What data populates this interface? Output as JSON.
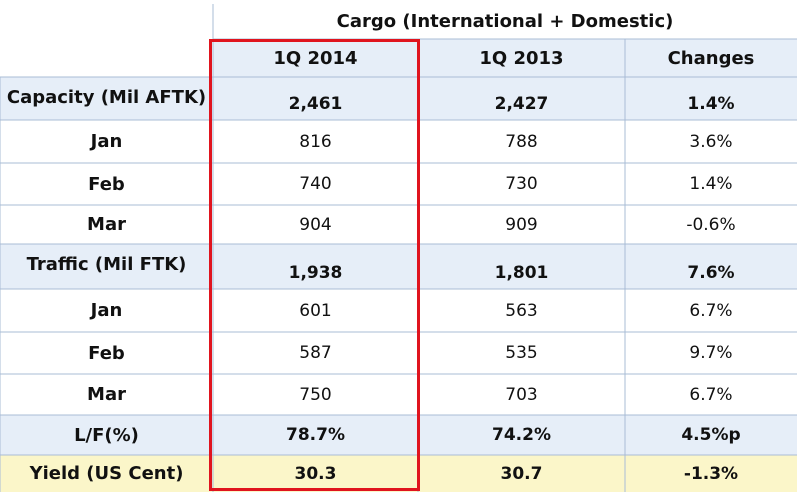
{
  "chart_data": {
    "type": "table",
    "group_header": "Cargo (International + Domestic)",
    "columns": [
      "1Q 2014",
      "1Q 2013",
      "Changes"
    ],
    "rows": [
      {
        "label": "Capacity (Mil AFTK)",
        "values": [
          "2,461",
          "2,427",
          "1.4%"
        ],
        "style": "summary"
      },
      {
        "label": "Jan",
        "values": [
          "816",
          "788",
          "3.6%"
        ],
        "style": "detail"
      },
      {
        "label": "Feb",
        "values": [
          "740",
          "730",
          "1.4%"
        ],
        "style": "detail"
      },
      {
        "label": "Mar",
        "values": [
          "904",
          "909",
          "-0.6%"
        ],
        "style": "detail"
      },
      {
        "label": "Traffic (Mil FTK)",
        "values": [
          "1,938",
          "1,801",
          "7.6%"
        ],
        "style": "summary"
      },
      {
        "label": "Jan",
        "values": [
          "601",
          "563",
          "6.7%"
        ],
        "style": "detail"
      },
      {
        "label": "Feb",
        "values": [
          "587",
          "535",
          "9.7%"
        ],
        "style": "detail"
      },
      {
        "label": "Mar",
        "values": [
          "750",
          "703",
          "6.7%"
        ],
        "style": "detail"
      },
      {
        "label": "L/F(%)",
        "values": [
          "78.7%",
          "74.2%",
          "4.5%p"
        ],
        "style": "summary"
      },
      {
        "label": "Yield (US Cent)",
        "values": [
          "30.3",
          "30.7",
          "-1.3%"
        ],
        "style": "yield"
      }
    ],
    "highlighted_column": "1Q 2014",
    "colors": {
      "header_fill": "#e6eef8",
      "summary_fill": "#e6eef8",
      "detail_fill": "#ffffff",
      "yield_fill": "#fbf6c9",
      "grid_line": "#a9bcd6",
      "highlight_border": "#e0141e"
    }
  }
}
